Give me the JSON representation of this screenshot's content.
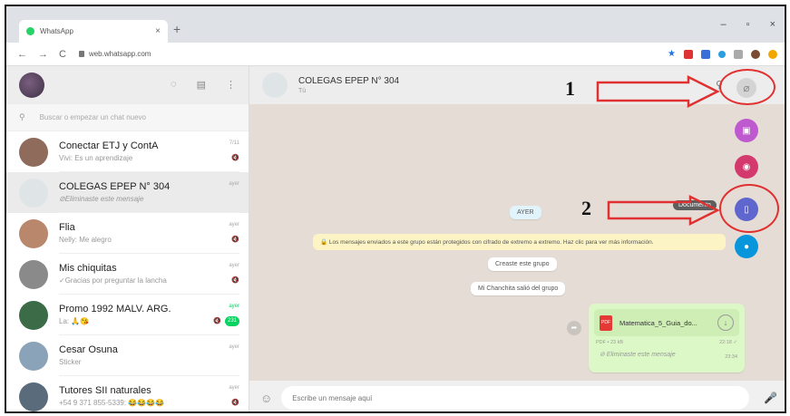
{
  "browser": {
    "tab_title": "WhatsApp",
    "tab_close": "×",
    "new_tab": "+",
    "url": "web.whatsapp.com",
    "window_controls": [
      "–",
      "▫",
      "×"
    ]
  },
  "sidebar": {
    "search_placeholder": "Buscar o empezar un chat nuevo",
    "chats": [
      {
        "name": "Conectar ETJ y ContA",
        "last": "Vivi: Es un aprendizaje",
        "time": "7/11",
        "mute": "🔇",
        "avatar_color": "#8e6b5a"
      },
      {
        "name": "COLEGAS EPEP N° 304",
        "last": "⊘Eliminaste este mensaje",
        "time": "ayer",
        "mute": "",
        "avatar_color": "#dfe5e7"
      },
      {
        "name": "Flia",
        "last": "Nelly: Me alegro",
        "time": "ayer",
        "mute": "🔇",
        "avatar_color": "#b9876c"
      },
      {
        "name": "Mis chiquitas",
        "last": "✓Gracias por preguntar la lancha",
        "time": "ayer",
        "mute": "🔇",
        "avatar_color": "#8a8a8a"
      },
      {
        "name": "Promo 1992 MALV. ARG.",
        "last": "La: 🙏😘",
        "time": "ayer",
        "mute": "🔇",
        "badge": "231",
        "avatar_color": "#3b6b47"
      },
      {
        "name": "Cesar Osuna",
        "last": "Sticker",
        "time": "ayer",
        "mute": "",
        "avatar_color": "#8ba3b8"
      },
      {
        "name": "Tutores SII naturales",
        "last": "+54 9 371 855-5339: 😂😂😂😂",
        "time": "ayer",
        "mute": "🔇",
        "avatar_color": "#5a6b7c"
      }
    ]
  },
  "conversation": {
    "title": "COLEGAS EPEP N° 304",
    "subtitle": "Tú",
    "date_pill": "AYER",
    "encryption_notice": "🔒 Los mensajes enviados a este grupo están protegidos con cifrado de extremo a extremo. Haz clic para ver más información.",
    "system_messages": [
      "Creaste este grupo",
      "Mi Chanchita salió del grupo"
    ],
    "document": {
      "filename": "Matematica_5_Guia_do...",
      "meta": "PDF • 23 kB",
      "time": "22:18 ✓",
      "pdf_label": "PDF"
    },
    "deleted_message": "⊘ Eliminaste este mensaje",
    "deleted_time": "23:34",
    "composer_placeholder": "Escribe un mensaje aquí"
  },
  "attach_menu": {
    "tooltip": "Documento",
    "items": [
      {
        "name": "photos-videos",
        "color": "#bf59cf"
      },
      {
        "name": "camera",
        "color": "#d3396d"
      },
      {
        "name": "document",
        "color": "#5f66cd"
      },
      {
        "name": "contact",
        "color": "#0795dc"
      }
    ]
  },
  "annotations": {
    "label_1": "1",
    "label_2": "2",
    "accent": "#e03030"
  }
}
